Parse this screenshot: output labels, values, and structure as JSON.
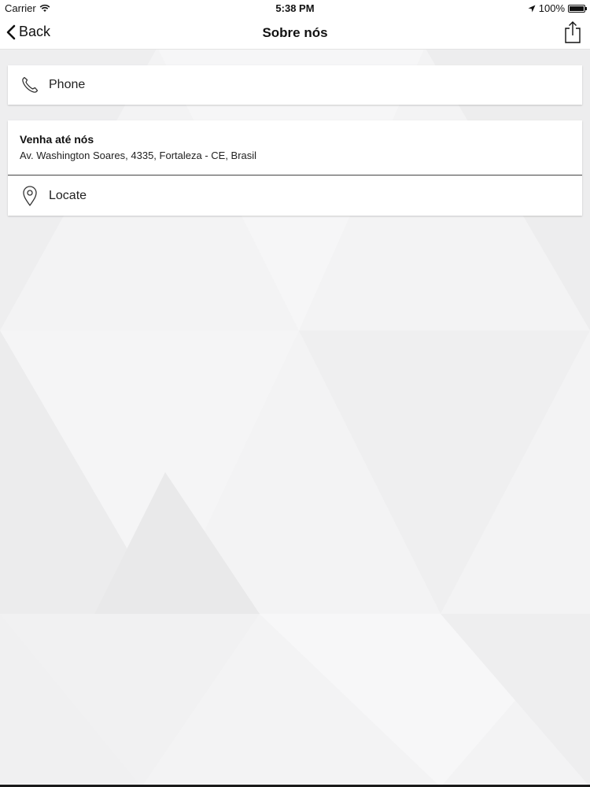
{
  "status_bar": {
    "carrier": "Carrier",
    "time": "5:38 PM",
    "battery": "100%",
    "icons": [
      "wifi-icon",
      "location-arrow-icon",
      "battery-icon"
    ]
  },
  "nav": {
    "back_label": "Back",
    "title": "Sobre nós",
    "back_icon": "chevron-left-icon",
    "share_icon": "share-icon"
  },
  "phone": {
    "label": "Phone",
    "icon": "phone-icon"
  },
  "address": {
    "title": "Venha até nós",
    "text": "Av. Washington Soares, 4335, Fortaleza - CE, Brasil"
  },
  "locate": {
    "label": "Locate",
    "icon": "map-pin-icon"
  },
  "colors": {
    "background": "#f4f4f5",
    "card": "#ffffff",
    "text": "#111111"
  }
}
